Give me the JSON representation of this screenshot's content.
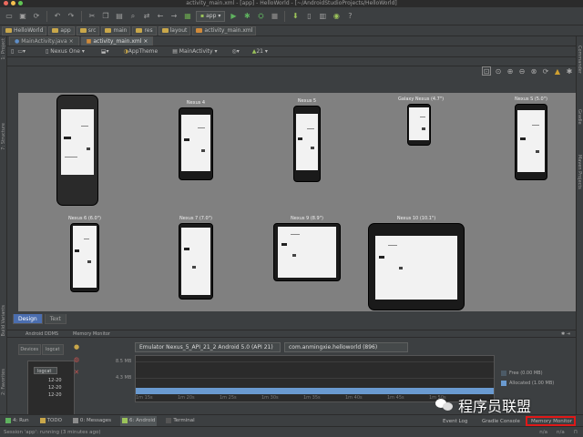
{
  "window": {
    "title": "activity_main.xml - [app] - HelloWorld - [~/AndroidStudioProjects/HelloWorld]"
  },
  "toolbar": {
    "run_config": "app"
  },
  "breadcrumb": [
    "HelloWorld",
    "app",
    "src",
    "main",
    "res",
    "layout",
    "activity_main.xml"
  ],
  "editor_tabs": [
    {
      "label": "MainActivity.java",
      "active": false
    },
    {
      "label": "activity_main.xml",
      "active": true
    }
  ],
  "design_toolbar": {
    "device": "Nexus One",
    "theme": "AppTheme",
    "activity": "MainActivity",
    "api": "21"
  },
  "left_strip_tabs": [
    "1: Project",
    "7: Structure",
    "Build Variants",
    "2: Favorites"
  ],
  "right_strip_tabs": [
    "Commander",
    "Gradle",
    "Maven Projects"
  ],
  "devices": [
    {
      "label": "",
      "key": "nexus-one"
    },
    {
      "label": "Nexus 4",
      "key": "nexus-4"
    },
    {
      "label": "Nexus 5",
      "key": "nexus-5"
    },
    {
      "label": "Galaxy Nexus (4.7\")",
      "key": "galaxy-nexus"
    },
    {
      "label": "Nexus S (5.0\")",
      "key": "nexus-s"
    },
    {
      "label": "Nexus 6 (6.0\")",
      "key": "nexus-6"
    },
    {
      "label": "Nexus 7 (7.0\")",
      "key": "nexus-7"
    },
    {
      "label": "Nexus 9 (8.9\")",
      "key": "nexus-9"
    },
    {
      "label": "Nexus 10 (10.1\")",
      "key": "nexus-10"
    }
  ],
  "view_tabs": [
    {
      "label": "Design",
      "active": true
    },
    {
      "label": "Text",
      "active": false
    }
  ],
  "panel": {
    "left_title": "Android DDMS",
    "right_title": "Memory Monitor",
    "devices_tab": "Devices",
    "logcat_tab": "logcat",
    "log_tag": "logcat",
    "log_times": [
      "12-20",
      "12-20",
      "12-20"
    ],
    "emulator": "Emulator Nexus_5_API_21_2 Android 5.0 (API 21)",
    "process": "com.anmingxie.helloworld (896)",
    "y_labels": [
      "8.5 MB",
      "4.3 MB"
    ],
    "x_labels": [
      "1m 15s",
      "1m 20s",
      "1m 25s",
      "1m 30s",
      "1m 35s",
      "1m 40s",
      "1m 45s",
      "1m 50s"
    ],
    "legend_free": "Free (0.00 MB)",
    "legend_allocated": "Allocated (1.00 MB)",
    "free_color": "#4c5a66",
    "allocated_color": "#6a9ad0"
  },
  "tool_windows": {
    "run": "4: Run",
    "todo": "TODO",
    "messages": "0: Messages",
    "android": "6: Android",
    "terminal": "Terminal",
    "event_log": "Event Log",
    "gradle_console": "Gradle Console",
    "memory_monitor": "Memory Monitor"
  },
  "status": {
    "message": "Session 'app': running (3 minutes ago)",
    "position": "n/a",
    "context": "n/a"
  },
  "watermark": {
    "text": "程序员联盟"
  },
  "colors": {
    "accent": "#4b6eaf",
    "highlight": "#e01818"
  }
}
